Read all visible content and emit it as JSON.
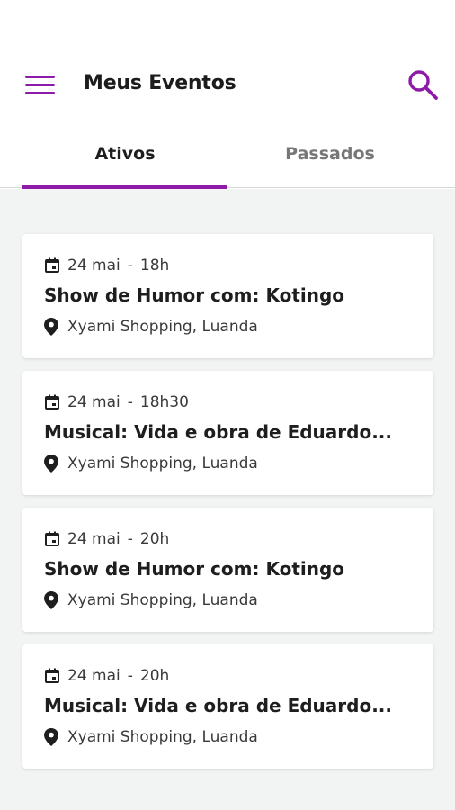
{
  "header": {
    "title": "Meus Eventos",
    "accent_color": "#8e1aa8",
    "menu_icon": "menu-icon",
    "search_icon": "search-icon"
  },
  "tabs": [
    {
      "label": "Ativos",
      "active": true
    },
    {
      "label": "Passados",
      "active": false
    }
  ],
  "events": [
    {
      "date": "24 mai",
      "time": "18h",
      "title": "Show de Humor com: Kotingo",
      "location": "Xyami Shopping, Luanda"
    },
    {
      "date": "24 mai",
      "time": "18h30",
      "title": "Musical: Vida e obra de Eduardo...",
      "location": "Xyami Shopping, Luanda"
    },
    {
      "date": "24 mai",
      "time": "20h",
      "title": "Show de Humor com: Kotingo",
      "location": "Xyami Shopping, Luanda"
    },
    {
      "date": "24 mai",
      "time": "20h",
      "title": "Musical: Vida e obra de Eduardo...",
      "location": "Xyami Shopping, Luanda"
    }
  ]
}
